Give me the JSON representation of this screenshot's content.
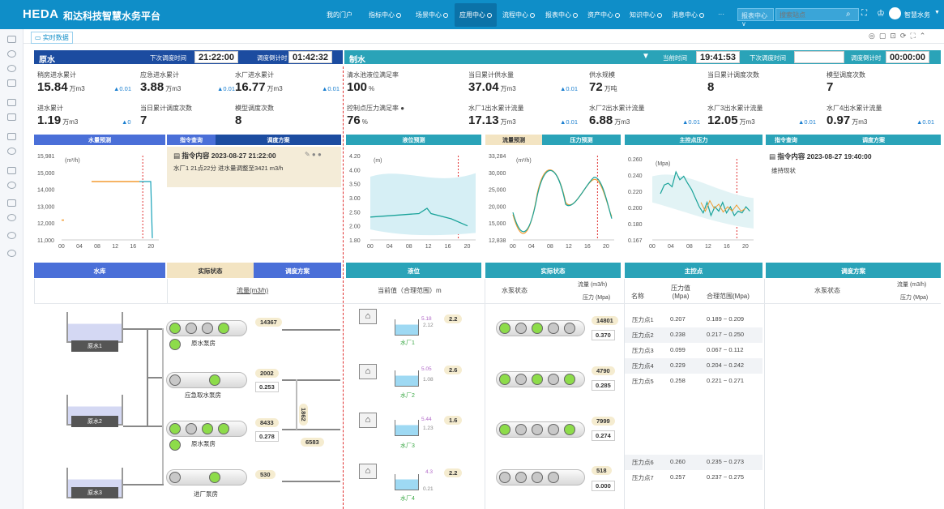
{
  "header": {
    "logo": "HEDA",
    "title": "和达科技智慧水务平台",
    "nav": [
      "我的门户",
      "指标中心",
      "场景中心",
      "应用中心",
      "流程中心",
      "报表中心",
      "资产中心",
      "知识中心",
      "消息中心",
      "···"
    ],
    "active_nav": "应用中心",
    "select": "报表中心 ∨",
    "search_placeholder": "搜索站点",
    "user": "智慧水务"
  },
  "subbar": {
    "tab": "实时数据"
  },
  "raw": {
    "title": "原水",
    "next_label": "下次调度时间",
    "next_time": "21:22:00",
    "countdown_label": "调度倒计时",
    "countdown": "01:42:32",
    "stats": [
      {
        "label": "稍房进水累计",
        "value": "15.84",
        "unit": "万m3",
        "delta": "▲0.01"
      },
      {
        "label": "应急进水累计",
        "value": "3.88",
        "unit": "万m3",
        "delta": "▲0.01"
      },
      {
        "label": "水厂进水累计",
        "value": "16.77",
        "unit": "万m3",
        "delta": "▲0.01"
      },
      {
        "label": "进水累计",
        "value": "1.19",
        "unit": "万m3",
        "delta": "▲0"
      },
      {
        "label": "当日累计调度次数",
        "value": "7",
        "unit": "",
        "delta": ""
      },
      {
        "label": "模型调度次数",
        "value": "8",
        "unit": "",
        "delta": ""
      }
    ]
  },
  "make": {
    "title": "制水",
    "cur_label": "当前时间",
    "cur_time": "19:41:53",
    "next_label": "下次调度时间",
    "countdown_label": "调度倒计时",
    "countdown": "00:00:00",
    "stats_row1": [
      {
        "label": "清水池液位满足率",
        "value": "100",
        "unit": "%",
        "delta": ""
      },
      {
        "label": "当日累计供水量",
        "value": "37.04",
        "unit": "万m3",
        "delta": "▲0.01"
      },
      {
        "label": "供水规模",
        "value": "72",
        "unit": "万吨",
        "delta": ""
      },
      {
        "label": "当日累计调度次数",
        "value": "8",
        "unit": "",
        "delta": ""
      },
      {
        "label": "模型调度次数",
        "value": "7",
        "unit": "",
        "delta": ""
      }
    ],
    "stats_row2": [
      {
        "label": "控制点压力满足率",
        "value": "76",
        "unit": "%",
        "delta": ""
      },
      {
        "label": "水厂1出水累计流量",
        "value": "17.13",
        "unit": "万m3",
        "delta": "▲0.01"
      },
      {
        "label": "水厂2出水累计流量",
        "value": "6.88",
        "unit": "万m3",
        "delta": "▲0.01"
      },
      {
        "label": "水厂3出水累计流量",
        "value": "12.05",
        "unit": "万m3",
        "delta": "▲0.01"
      },
      {
        "label": "水厂4出水累计流量",
        "value": "0.97",
        "unit": "万m3",
        "delta": "▲0.01"
      }
    ]
  },
  "cards": {
    "flow": "水量预测",
    "cmd": "指令查询",
    "plan": "调度方案",
    "level": "液位预测",
    "flowpred": "流量预测",
    "pressurepred": "压力预测",
    "keypress": "主控点压力",
    "cmd2": "指令查询",
    "plan2": "调度方案"
  },
  "cmd1": {
    "title": "指令内容 2023-08-27 21:22:00",
    "body": "水厂1 21点22分 进水量调整至3421 m3/h"
  },
  "cmd2": {
    "title": "指令内容 2023-08-27 19:40:00",
    "body": "维持现状"
  },
  "chart_data": [
    {
      "type": "line",
      "title": "水量预测",
      "ylabel": "(m³/h)",
      "x_ticks": [
        "00",
        "04",
        "08",
        "12",
        "16",
        "20"
      ],
      "y_ticks": [
        "15,981",
        "15,000",
        "14,000",
        "13,000",
        "12,000",
        "11,000"
      ],
      "ylim": [
        11000,
        15981
      ]
    },
    {
      "type": "area",
      "title": "液位预测",
      "ylabel": "(m)",
      "x_ticks": [
        "00",
        "04",
        "08",
        "12",
        "16",
        "20"
      ],
      "y_ticks": [
        "4.20",
        "4.00",
        "3.50",
        "3.00",
        "2.50",
        "2.00",
        "1.80"
      ],
      "ylim": [
        1.8,
        4.2
      ]
    },
    {
      "type": "line",
      "title": "流量预测",
      "ylabel": "(m³/h)",
      "x_ticks": [
        "00",
        "04",
        "08",
        "12",
        "16",
        "20"
      ],
      "y_ticks": [
        "33,284",
        "30,000",
        "25,000",
        "20,000",
        "15,000",
        "12,838"
      ],
      "ylim": [
        12838,
        33284
      ]
    },
    {
      "type": "area",
      "title": "主控点压力",
      "ylabel": "(Mpa)",
      "x_ticks": [
        "00",
        "04",
        "08",
        "12",
        "16",
        "20"
      ],
      "y_ticks": [
        "0.260",
        "0.240",
        "0.220",
        "0.200",
        "0.180",
        "0.167"
      ],
      "ylim": [
        0.167,
        0.26
      ]
    }
  ],
  "tables": {
    "reservoir": "水库",
    "actual": "实际状态",
    "plan": "调度方案",
    "flowcol": "流量(m3/h)",
    "level": "液位",
    "levelcol": "当前值（合理范围）m",
    "actual2": "实际状态",
    "pumpstate": "水泵状态",
    "flowunit": "流量 (m3/h)",
    "pressunit": "压力 (Mpa)",
    "keypoint": "主控点",
    "name": "名称",
    "pval": "压力值(Mpa)",
    "range": "合理范围(Mpa)",
    "plan3": "调度方案",
    "pumpstate2": "水泵状态",
    "flowunit2": "流量 (m3/h)",
    "pressunit2": "压力 (Mpa)"
  },
  "reservoirs": [
    "原水1",
    "原水2",
    "原水3"
  ],
  "pumps": [
    {
      "name": "原水泵房",
      "flow": "14367"
    },
    {
      "name": "应急取水泵房",
      "flow": "2002",
      "press": "0.253"
    },
    {
      "name": "原水泵房",
      "flow": "8433",
      "press": "0.278",
      "extra": "6583",
      "vert": "1862"
    },
    {
      "name": "进厂泵房",
      "flow": "530"
    }
  ],
  "plants": [
    {
      "name": "水厂1",
      "top": "5.18",
      "cur": "2.12",
      "val": "2.2",
      "flow": "14801",
      "press": "0.370"
    },
    {
      "name": "水厂2",
      "top": "5.05",
      "cur": "1.08",
      "val": "2.6",
      "flow": "4790",
      "press": "0.285"
    },
    {
      "name": "水厂3",
      "top": "5.44",
      "cur": "1.23",
      "val": "1.6",
      "flow": "7999",
      "press": "0.274"
    },
    {
      "name": "水厂4",
      "top": "4.3",
      "cur": "0.21",
      "val": "2.2",
      "flow": "518",
      "press": "0.000"
    }
  ],
  "points": [
    {
      "name": "压力点1",
      "v": "0.207",
      "r": "0.189 ~ 0.209"
    },
    {
      "name": "压力点2",
      "v": "0.238",
      "r": "0.217 ~ 0.250"
    },
    {
      "name": "压力点3",
      "v": "0.099",
      "r": "0.067 ~ 0.112"
    },
    {
      "name": "压力点4",
      "v": "0.229",
      "r": "0.204 ~ 0.242"
    },
    {
      "name": "压力点5",
      "v": "0.258",
      "r": "0.221 ~ 0.271"
    },
    {
      "name": "压力点6",
      "v": "0.260",
      "r": "0.235 ~ 0.273"
    },
    {
      "name": "压力点7",
      "v": "0.257",
      "r": "0.237 ~ 0.275"
    }
  ],
  "colors": {
    "brand": "#0f8ec8",
    "navy": "#1c4ca0",
    "accent": "#4a6fd8",
    "teal": "#2aa3b8"
  }
}
